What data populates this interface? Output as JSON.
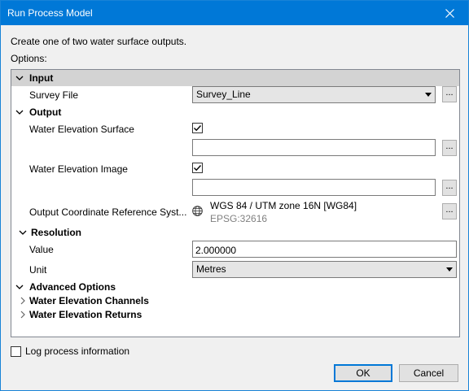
{
  "window": {
    "title": "Run Process Model"
  },
  "description": "Create one of two water surface outputs.",
  "options_label": "Options:",
  "sections": {
    "input": {
      "label": "Input",
      "survey_file": {
        "label": "Survey File",
        "value": "Survey_Line",
        "browse": "..."
      }
    },
    "output": {
      "label": "Output",
      "water_elevation_surface": {
        "label": "Water Elevation Surface",
        "checked": true,
        "path": "",
        "browse": "..."
      },
      "water_elevation_image": {
        "label": "Water Elevation Image",
        "checked": true,
        "path": "",
        "browse": "..."
      },
      "crs": {
        "label": "Output Coordinate Reference Syst...",
        "name": "WGS 84 / UTM zone 16N [WG84]",
        "code": "EPSG:32616",
        "browse": "..."
      }
    },
    "resolution": {
      "label": "Resolution",
      "value": {
        "label": "Value",
        "value": "2.000000"
      },
      "unit": {
        "label": "Unit",
        "value": "Metres"
      }
    },
    "advanced": {
      "label": "Advanced Options"
    },
    "channels": {
      "label": "Water Elevation Channels"
    },
    "returns": {
      "label": "Water Elevation Returns"
    }
  },
  "log_process": {
    "label": "Log process information",
    "checked": false
  },
  "buttons": {
    "ok": "OK",
    "cancel": "Cancel"
  },
  "icons": {
    "close": "close-icon",
    "expanded": "chevron-down-icon",
    "collapsed": "chevron-right-icon",
    "dropdown": "caret-down-icon",
    "crs": "globe-icon",
    "check": "checkmark-icon"
  },
  "colors": {
    "titlebar": "#0078d7",
    "section_header": "#d3d3d3",
    "accent": "#0078d7"
  }
}
